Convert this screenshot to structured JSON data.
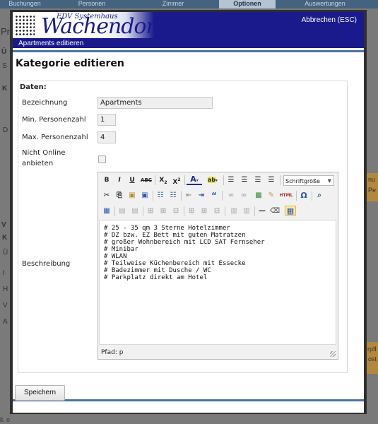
{
  "background": {
    "tabs": [
      "Buchungen",
      "Personen",
      "Zimmer",
      "Optionen",
      "Auswertungen"
    ],
    "active_tab": "Optionen",
    "frag_pr": "Pr",
    "frag_u": "Ü",
    "frag_s": "S",
    "frag_k": "K",
    "frag_d": "D",
    "frag_v": "V",
    "frag_k2": "K",
    "frag_u2": "Ü",
    "frag_i": "I",
    "frag_h": "H",
    "frag_v2": "V",
    "frag_a": "A",
    "frag_right1": "nu",
    "frag_right2": "Pe",
    "frag_right3": "rpfl",
    "frag_right4": "ost",
    "frag_bottom": "ll. o"
  },
  "modal": {
    "logo_sub": "EDV Systemhaus",
    "logo_main": "Wachendorf",
    "cancel_label": "Abbrechen (ESC)",
    "subtitle": "Apartments editieren",
    "title": "Kategorie editieren",
    "legend": "Daten:",
    "fields": {
      "bezeichnung_label": "Bezeichnung",
      "bezeichnung_value": "Apartments",
      "min_label": "Min. Personenzahl",
      "min_value": "1",
      "max_label": "Max. Personenzahl",
      "max_value": "4",
      "online_label_1": "Nicht Online",
      "online_label_2": "anbieten",
      "online_checked": false,
      "beschreibung_label": "Beschreibung"
    },
    "editor": {
      "font_size_label": "Schriftgröße",
      "lines": [
        "# 25 - 35 qm 3 Sterne Hotelzimmer",
        "# DZ bzw. EZ Bett mit guten Matratzen",
        "# großer Wohnbereich mit LCD SAT Fernseher",
        "# Minibar",
        "# WLAN",
        "# Teilweise Küchenbereich mit Essecke",
        "# Badezimmer mit Dusche / WC",
        "# Parkplatz direkt am Hotel"
      ],
      "path_label": "Pfad: p"
    },
    "save_label": "Speichern"
  },
  "colors": {
    "header_blue": "#1a1a8c",
    "accent_line": "#4c72a4",
    "background_dim": "#7a7a7a"
  }
}
